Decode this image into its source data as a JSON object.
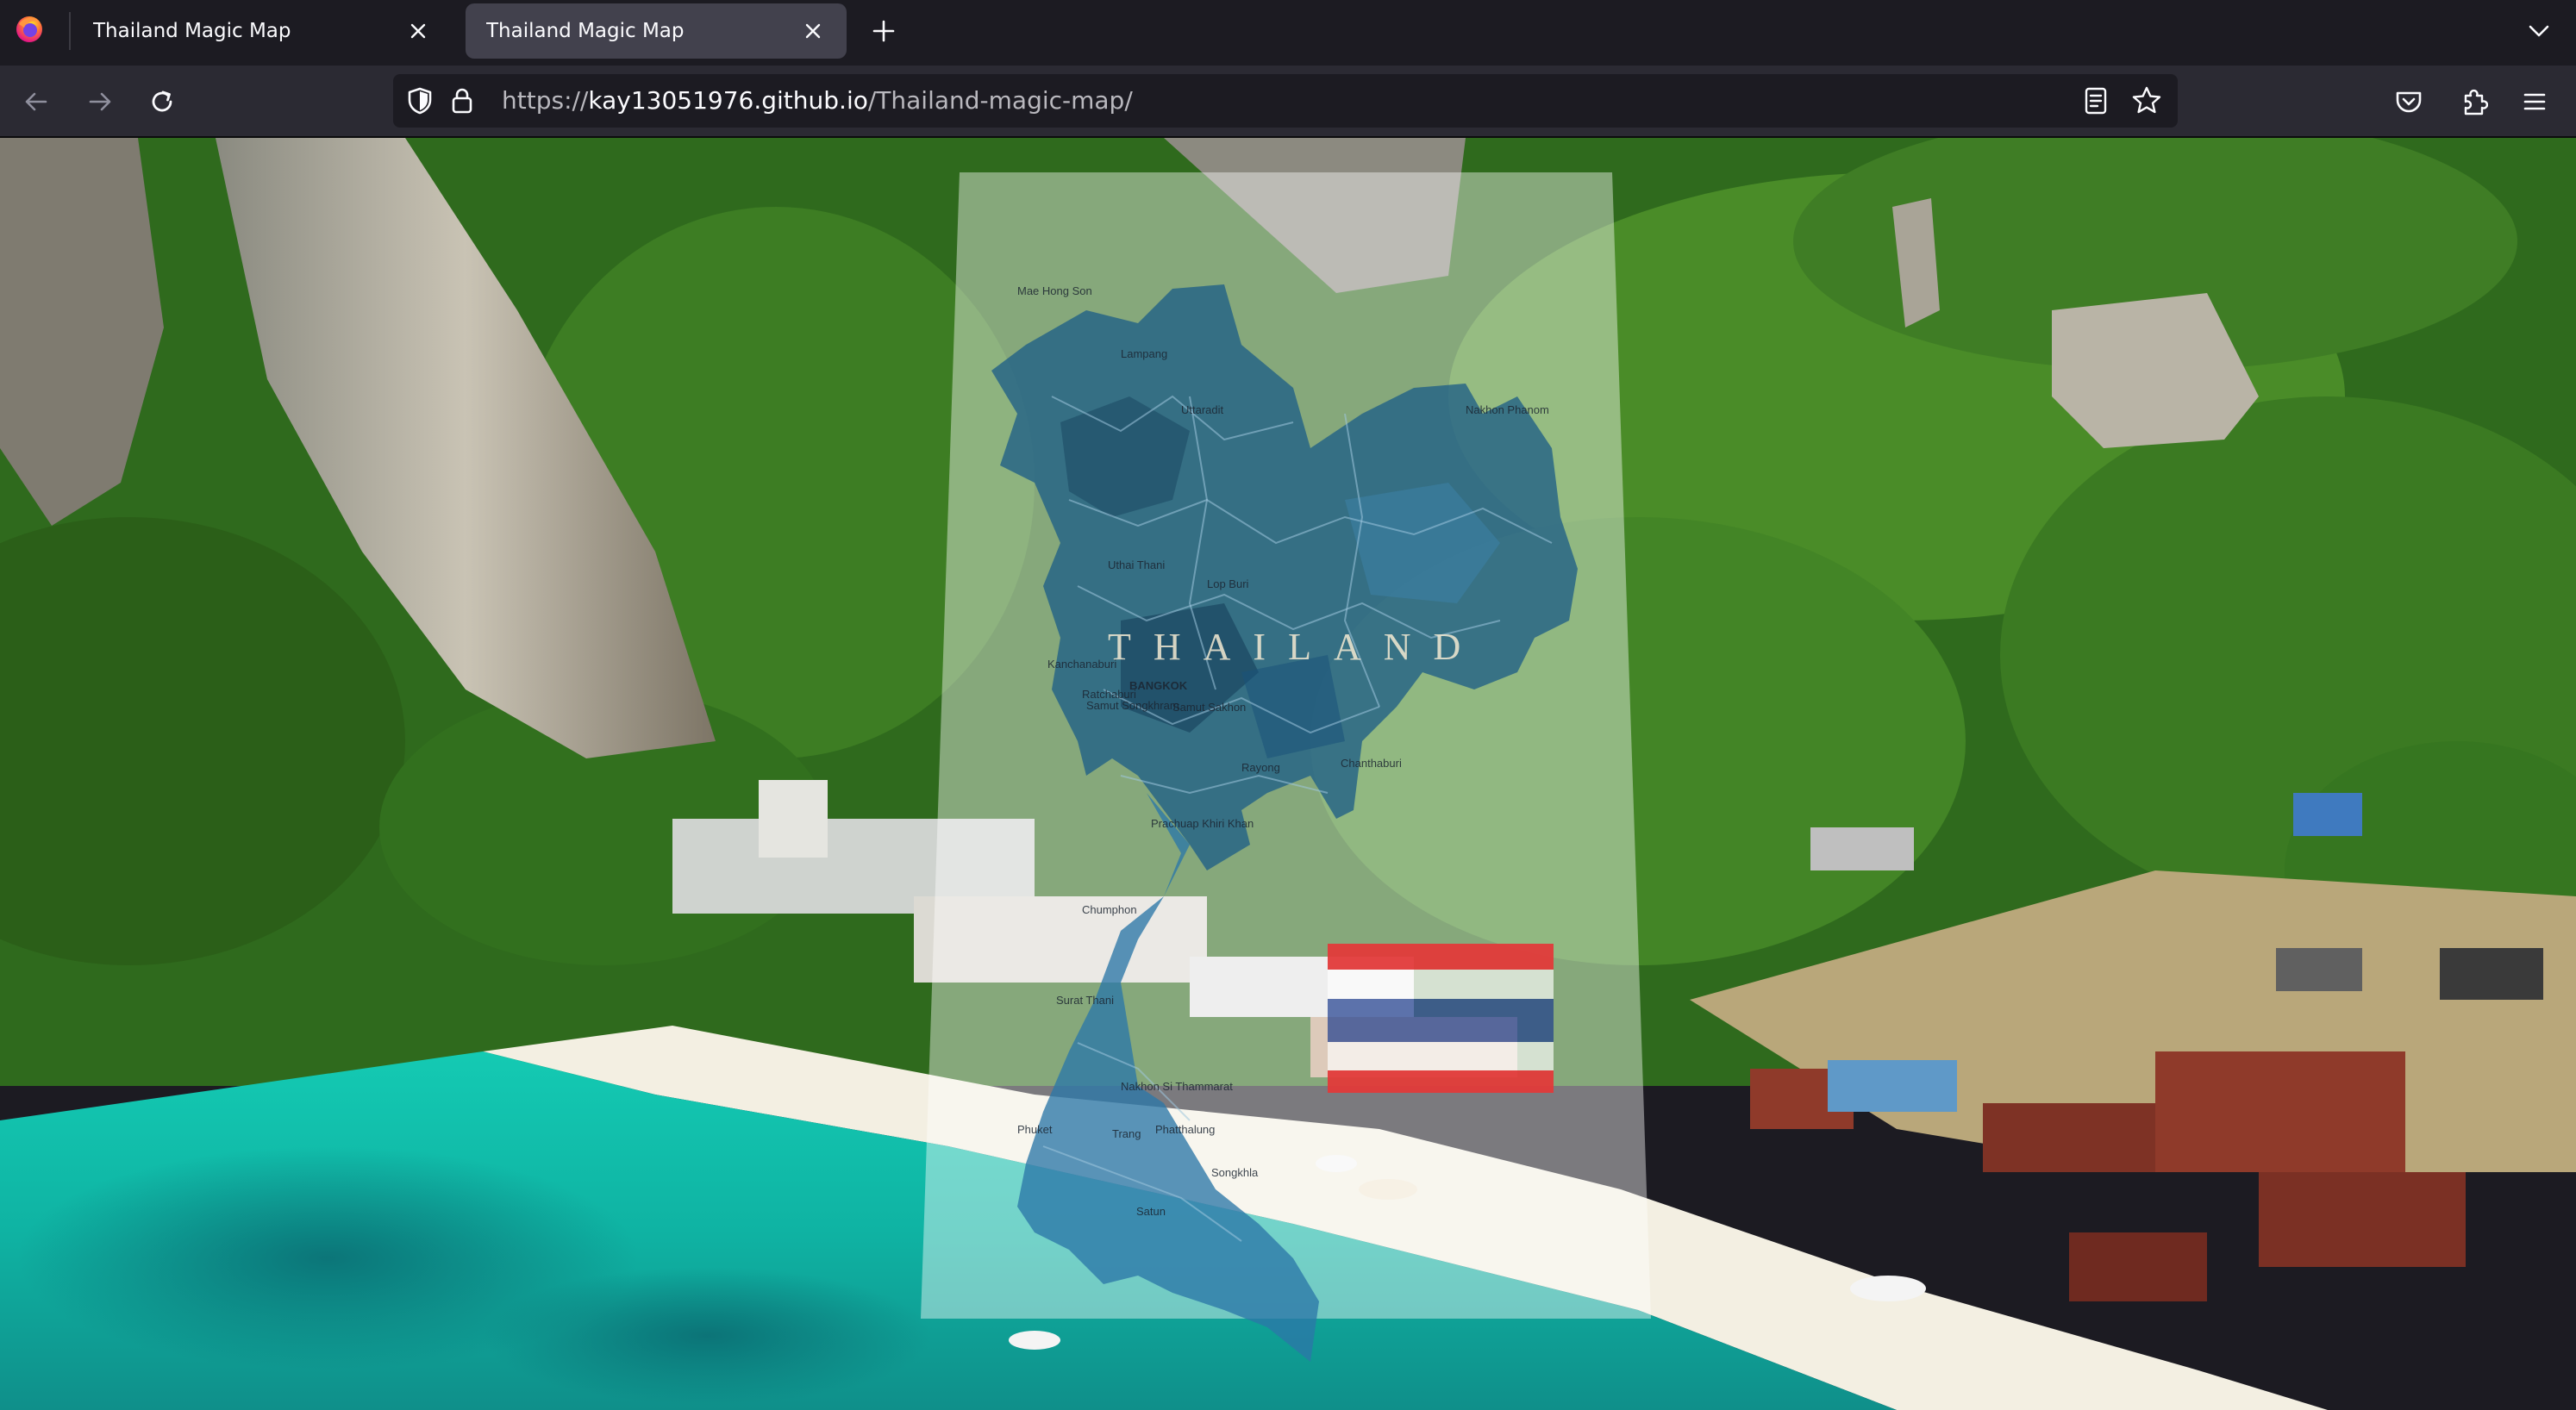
{
  "browser": {
    "tabs": [
      {
        "title": "Thailand Magic Map",
        "active": false
      },
      {
        "title": "Thailand Magic Map",
        "active": true
      }
    ],
    "url": {
      "scheme": "https://",
      "host": "kay13051976.github.io",
      "path": "/Thailand-magic-map/"
    },
    "icons": [
      "firefox-logo",
      "close-icon",
      "plus-icon",
      "chevron-down-icon",
      "arrow-left-icon",
      "arrow-right-icon",
      "reload-icon",
      "shield-icon",
      "lock-icon",
      "reader-view-icon",
      "star-icon",
      "pocket-icon",
      "puzzle-icon",
      "hamburger-menu-icon"
    ]
  },
  "page": {
    "map": {
      "title": "THAILAND",
      "labels": {
        "mae_hong_son": "Mae Hong Son",
        "lampang": "Lampang",
        "uttaradit": "Uttaradit",
        "nakhon_phanom": "Nakhon Phanom",
        "uthai_thani": "Uthai Thani",
        "lop_buri": "Lop Buri",
        "kanchanaburi": "Kanchanaburi",
        "bangkok": "BANGKOK",
        "samut_songkhram": "Samut Songkhram",
        "samut_sakhon": "Samut Sakhon",
        "ratchaburi": "Ratchaburi",
        "rayong": "Rayong",
        "chanthaburi": "Chanthaburi",
        "prachuap": "Prachuap Khiri Khan",
        "chumphon": "Chumphon",
        "surat_thani": "Surat Thani",
        "nakhon_si": "Nakhon Si Thammarat",
        "phuket": "Phuket",
        "trang": "Trang",
        "phatthalung": "Phatthalung",
        "songkhla": "Songkhla",
        "satun": "Satun"
      }
    },
    "colors": {
      "map_blue": "#1f5f86",
      "map_blue_light": "#3d86b0",
      "flag_red": "#e23a3a",
      "flag_blue": "#1e3d8f",
      "panel_white": "#ffffff",
      "sea_turquoise": "#1fc6b6",
      "forest_green": "#2e6b1c"
    }
  }
}
